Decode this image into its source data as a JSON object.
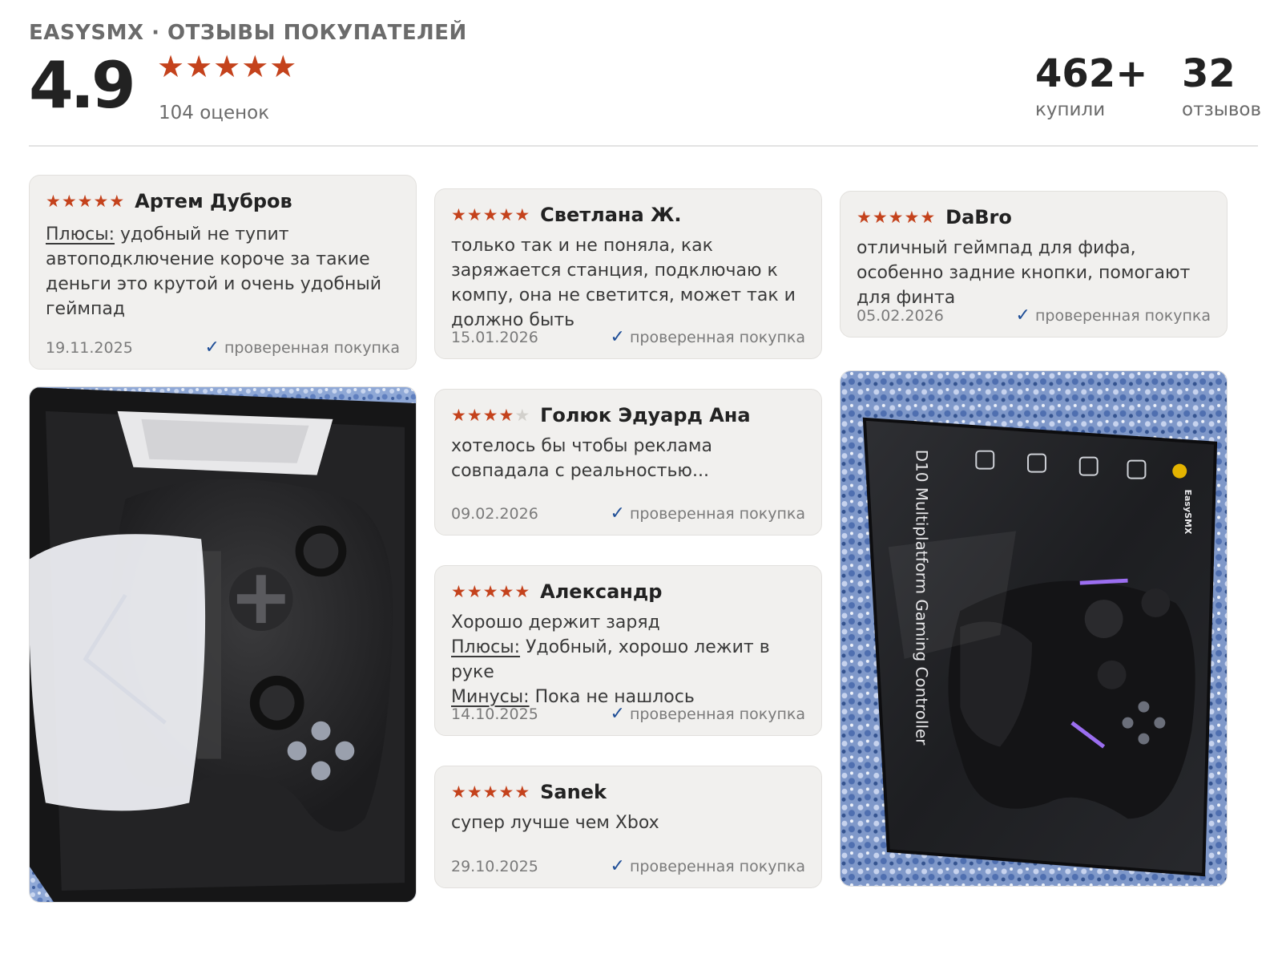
{
  "header": {
    "brand": "EASYSMX · ОТЗЫВЫ ПОКУПАТЕЛЕЙ",
    "rating": "4.9",
    "stars": "★★★★★",
    "ratings_count": "104 оценок",
    "bought_count": "462+",
    "bought_label": "купили",
    "reviews_count": "32",
    "reviews_label": "отзывов"
  },
  "colors": {
    "star": "#c4421c",
    "check": "#1f4e97",
    "card_bg": "#f1f0ee"
  },
  "reviews": [
    {
      "author": "Артем Дубров",
      "rating": 5,
      "pros_label": "Плюсы:",
      "pros": "удобный не тупит автоподключение короче за такие деньги это крутой и очень удобный геймпад",
      "date": "19.11.2025",
      "verified": "проверенная покупка"
    },
    {
      "author": "Светлана Ж.",
      "rating": 5,
      "text": "только так и не поняла, как заряжается станция, подключаю к компу, она не светится, может так и должно быть",
      "date": "15.01.2026",
      "verified": "проверенная покупка"
    },
    {
      "author": "DaBro",
      "rating": 5,
      "text": "отличный геймпад для фифа, особенно задние кнопки, помогают для финта",
      "date": "05.02.2026",
      "verified": "проверенная покупка"
    },
    {
      "author": "Голюк Эдуард Ана",
      "rating": 4,
      "text": "хотелось бы чтобы реклама совпадала с реальностью...",
      "date": "09.02.2026",
      "verified": "проверенная покупка"
    },
    {
      "author": "Александр",
      "rating": 5,
      "text": "Хорошо держит заряд",
      "pros_label": "Плюсы:",
      "pros": "Удобный, хорошо лежит в руке",
      "cons_label": "Минусы:",
      "cons": "Пока не нашлось",
      "date": "14.10.2025",
      "verified": "проверенная покупка"
    },
    {
      "author": "Sanek",
      "rating": 5,
      "text": "супер лучше чем Xbox",
      "date": "29.10.2025",
      "verified": "проверенная покупка"
    }
  ],
  "photos": {
    "box_brand": "EasySMX",
    "box_title": "D10 Multiplatform Gaming Controller"
  }
}
